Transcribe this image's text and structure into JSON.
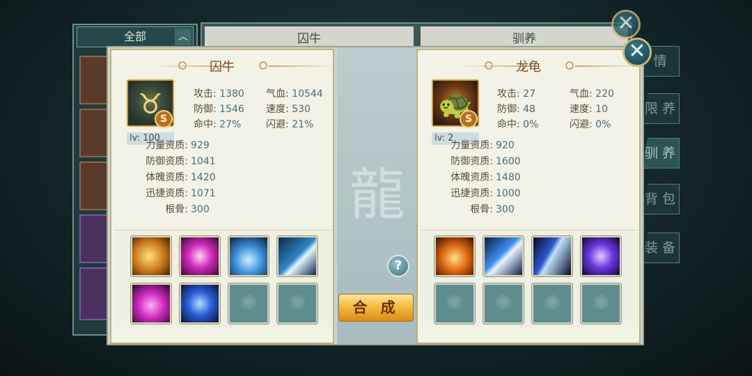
{
  "background": {
    "filter_label": "全部",
    "tab_left": "囚牛",
    "tab_right": "驯养",
    "side_tabs": [
      "情",
      "限 养",
      "驯 养",
      "背 包",
      "装 备"
    ]
  },
  "dialog": {
    "combine_label": "合 成",
    "help_label": "?",
    "close_label": "✕",
    "left": {
      "name": "囚牛",
      "grade": "S",
      "level": "lv: 100",
      "stats": [
        {
          "label": "攻击:",
          "value": "1380"
        },
        {
          "label": "气血:",
          "value": "10544"
        },
        {
          "label": "防御:",
          "value": "1546"
        },
        {
          "label": "速度:",
          "value": "530"
        },
        {
          "label": "命中:",
          "value": "27%"
        },
        {
          "label": "闪避:",
          "value": "21%"
        }
      ],
      "aptitudes": [
        {
          "label": "力量资质:",
          "value": "929"
        },
        {
          "label": "防御资质:",
          "value": "1041"
        },
        {
          "label": "体魄资质:",
          "value": "1420"
        },
        {
          "label": "迅捷资质:",
          "value": "1071"
        },
        {
          "label": "根骨:",
          "value": "300"
        }
      ],
      "skills": [
        "lion-roar-skill-icon",
        "purple-vortex-skill-icon",
        "blue-heart-skill-icon",
        "lightning-skill-icon",
        "pink-heart-skill-icon",
        "blue-swirl-skill-icon",
        "empty-slot",
        "empty-slot"
      ]
    },
    "right": {
      "name": "龙龟",
      "grade": "S",
      "level": "lv: 2",
      "stats": [
        {
          "label": "攻击:",
          "value": "27"
        },
        {
          "label": "气血:",
          "value": "220"
        },
        {
          "label": "防御:",
          "value": "48"
        },
        {
          "label": "速度:",
          "value": "10"
        },
        {
          "label": "命中:",
          "value": "0%"
        },
        {
          "label": "闪避:",
          "value": "0%"
        }
      ],
      "aptitudes": [
        {
          "label": "力量资质:",
          "value": "920"
        },
        {
          "label": "防御资质:",
          "value": "1600"
        },
        {
          "label": "体魄资质:",
          "value": "1480"
        },
        {
          "label": "迅捷资质:",
          "value": "1000"
        },
        {
          "label": "根骨:",
          "value": "300"
        }
      ],
      "skills": [
        "fire-shield-skill-icon",
        "lightning-arrow-skill-icon",
        "claw-slash-skill-icon",
        "purple-vortex-skill-icon",
        "empty-slot",
        "empty-slot",
        "empty-slot",
        "empty-slot"
      ]
    }
  }
}
